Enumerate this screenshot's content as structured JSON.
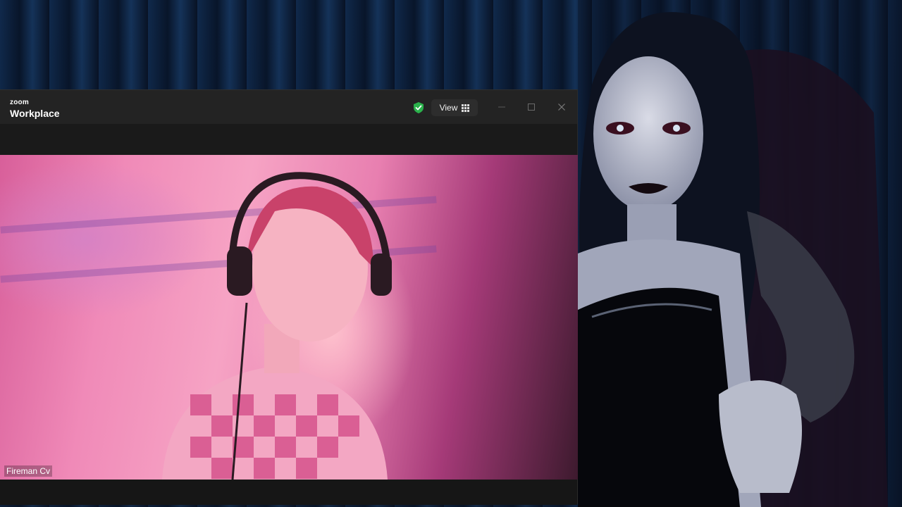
{
  "window": {
    "brand_top": "zoom",
    "brand_main": "Workplace",
    "view_label": "View"
  },
  "icons": {
    "security": "shield-check-icon",
    "view": "grid-icon",
    "minimize": "minimize-icon",
    "maximize": "maximize-icon",
    "close": "close-icon"
  },
  "video": {
    "participant_name": "Fireman Cv"
  },
  "colors": {
    "shield": "#2bb24c",
    "titlebar": "#232323",
    "window_bg": "#1a1a1a"
  }
}
